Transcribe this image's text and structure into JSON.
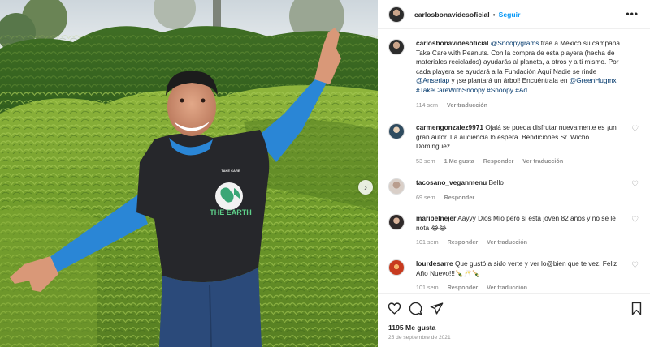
{
  "post": {
    "username": "carlosbonavidesoficial",
    "separator": "•",
    "follow_label": "Seguir",
    "more_label": "•••",
    "carousel_next": "›"
  },
  "shirt": {
    "small_text": "TAKE CARE",
    "big_text": "THE EARTH"
  },
  "caption": {
    "username": "carlosbonavidesoficial",
    "mention1": "@Snoopygrams",
    "text1": " trae a México su campaña Take Care with Peanuts. Con la compra de esta playera (hecha de materiales reciclados) ayudarás al planeta, a otros y a ti mismo. Por cada playera se ayudará a la Fundación Aquí Nadie se rinde ",
    "mention2": "@Anseriap",
    "text2": " y ¡se plantará un árbol! Encuéntrala en ",
    "mention3": "@GreenHugmx",
    "hashtags": " #TakeCareWithSnoopy #Snoopy #Ad",
    "time": "114 sem",
    "translate": "Ver traducción"
  },
  "comments": [
    {
      "username": "carmengonzalez9971",
      "text": " Ojalá se pueda disfrutar nuevamente es ¡un gran autor. La audiencia lo espera. Bendiciones Sr. Wicho Dominguez.",
      "time": "53 sem",
      "likes": "1 Me gusta",
      "reply": "Responder",
      "translate": "Ver traducción"
    },
    {
      "username": "tacosano_veganmenu",
      "text": " Bello",
      "time": "69 sem",
      "reply": "Responder"
    },
    {
      "username": "maribelnejer",
      "text": " Aayyy Dios Mío pero si está joven 82 años y no se le nota 😂😂",
      "time": "101 sem",
      "reply": "Responder",
      "translate": "Ver traducción"
    },
    {
      "username": "lourdesarre",
      "text": " Que gustó a sido verte y ver lo@bien que te vez. Feliz Año Nuevo!!!🍾🥂🍾",
      "time": "101 sem",
      "reply": "Responder",
      "translate": "Ver traducción"
    }
  ],
  "footer": {
    "likes": "1195 Me gusta",
    "date": "25 de septiembre de 2021"
  },
  "icons": {
    "heart": "heart-icon",
    "comment": "comment-icon",
    "share": "share-icon",
    "save": "bookmark-icon"
  },
  "colors": {
    "link": "#00376b",
    "follow": "#0095f6",
    "muted": "#8e8e8e"
  }
}
